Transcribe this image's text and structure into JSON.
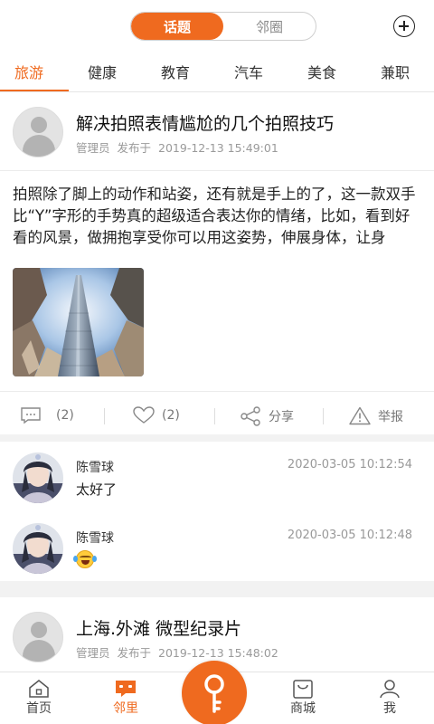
{
  "header": {
    "tabs": [
      {
        "label": "话题",
        "active": true
      },
      {
        "label": "邻圈",
        "active": false
      }
    ],
    "add_icon": "plus-circle-icon"
  },
  "categories": [
    {
      "label": "旅游",
      "active": true
    },
    {
      "label": "健康"
    },
    {
      "label": "教育"
    },
    {
      "label": "汽车"
    },
    {
      "label": "美食"
    },
    {
      "label": "兼职"
    }
  ],
  "posts": [
    {
      "title": "解决拍照表情尴尬的几个拍照技巧",
      "author": "管理员",
      "published_label": "发布于",
      "timestamp": "2019-12-13 15:49:01",
      "body": "拍照除了脚上的动作和站姿，还有就是手上的了，这一款双手比“Y”字形的手势真的超级适合表达你的情绪，比如，看到好看的风景，做拥抱享受你可以用这姿势，伸展身体，让身",
      "actions": {
        "comment_count": "(2)",
        "like_count": "(2)",
        "share_label": "分享",
        "report_label": "举报"
      },
      "comments": [
        {
          "name": "陈雪球",
          "time": "2020-03-05 10:12:54",
          "text": "太好了",
          "emoji": null
        },
        {
          "name": "陈雪球",
          "time": "2020-03-05 10:12:48",
          "text": "",
          "emoji": "laughing-crying-emoji"
        }
      ]
    },
    {
      "title": "上海.外滩 微型纪录片",
      "author": "管理员",
      "published_label": "发布于",
      "timestamp": "2019-12-13 15:48:02"
    }
  ],
  "bottom_nav": [
    {
      "label": "首页",
      "icon": "home-icon"
    },
    {
      "label": "邻里",
      "icon": "chat-icon",
      "active": true
    },
    {
      "label": "",
      "icon": "key-icon"
    },
    {
      "label": "商城",
      "icon": "shop-bag-icon"
    },
    {
      "label": "我",
      "icon": "user-icon"
    }
  ],
  "colors": {
    "accent": "#ef6a1f",
    "muted_text": "#9a9a9a"
  }
}
